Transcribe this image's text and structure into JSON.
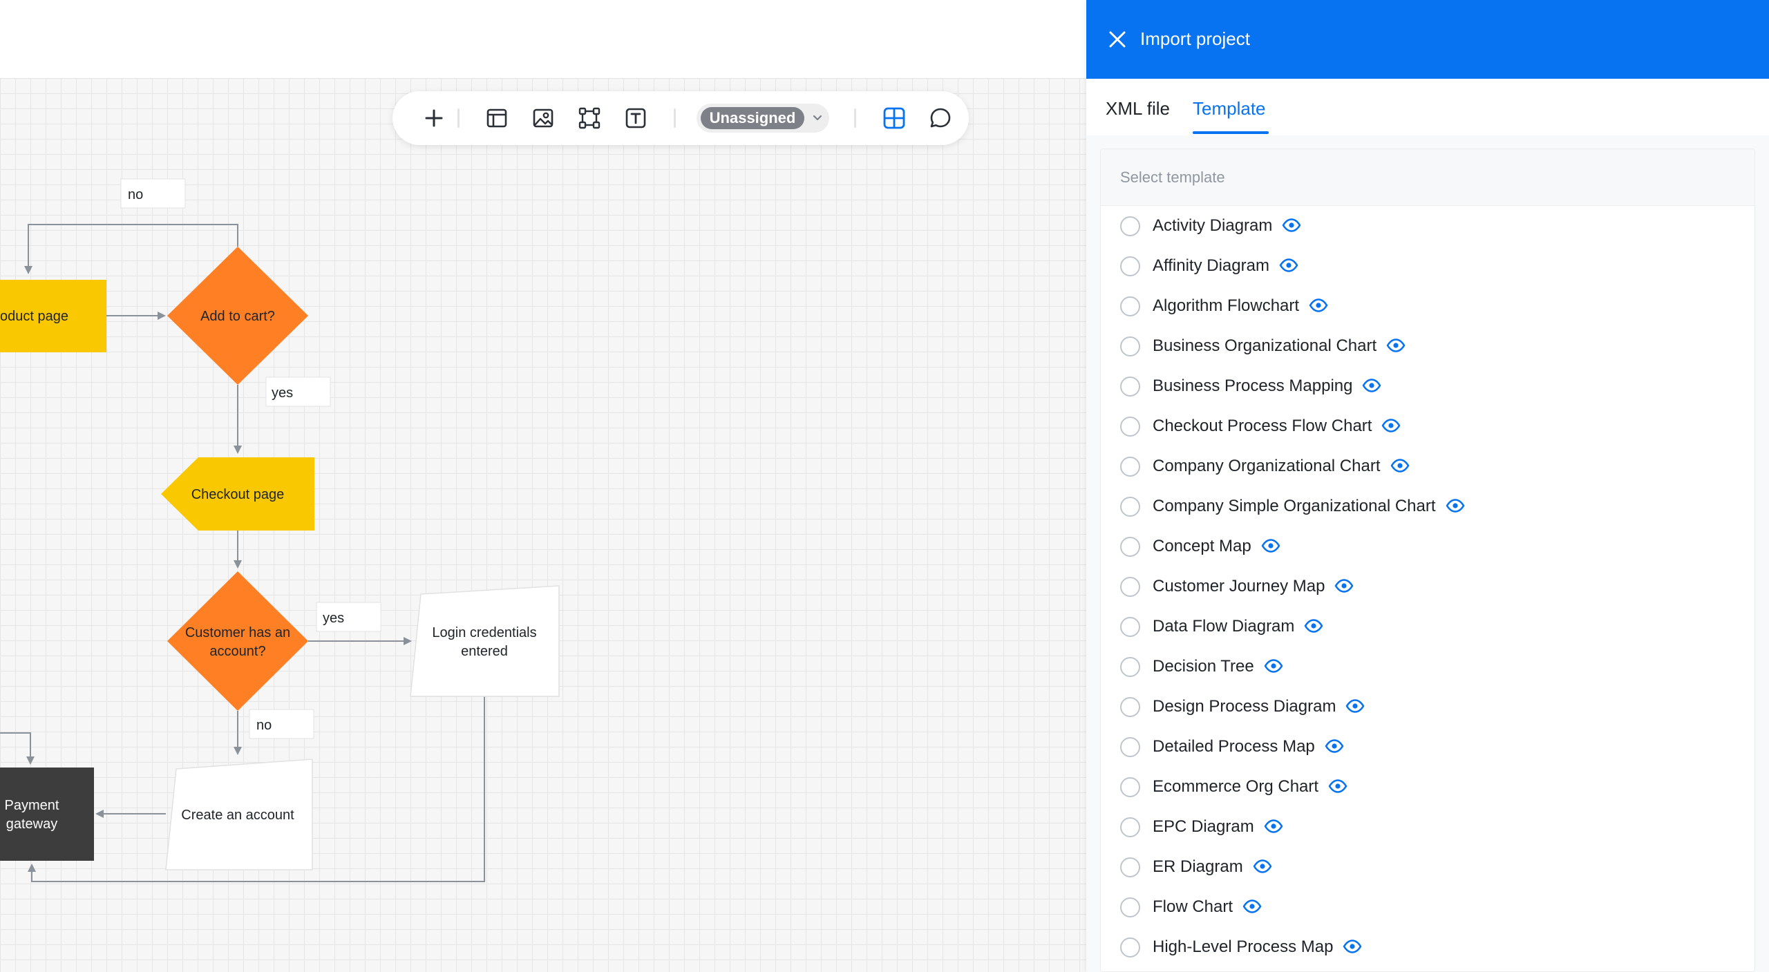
{
  "colors": {
    "accent": "#0773f0",
    "shape_yellow": "#fac800",
    "shape_orange": "#ff8024",
    "shape_dark": "#3d3d3d"
  },
  "toolbar": {
    "buttons": [
      "add-icon",
      "layout-icon",
      "image-icon",
      "frame-icon",
      "text-icon"
    ],
    "assign_label": "Unassigned",
    "right_buttons": [
      "grid-icon",
      "comment-icon"
    ]
  },
  "diagram": {
    "labels": {
      "no_top": "no",
      "yes_1": "yes",
      "yes_2": "yes",
      "no_bottom": "no"
    },
    "nodes": {
      "product_page": "oduct page",
      "add_to_cart": "Add to cart?",
      "checkout_page": "Checkout page",
      "customer_account_line1": "Customer has an",
      "customer_account_line2": "account?",
      "login_line1": "Login credentials",
      "login_line2": "entered",
      "payment_line1": "Payment",
      "payment_line2": "gateway",
      "create_account": "Create an account"
    }
  },
  "panel": {
    "title": "Import project",
    "tabs": [
      {
        "label": "XML file",
        "active": false
      },
      {
        "label": "Template",
        "active": true
      }
    ],
    "select_label": "Select template",
    "templates": [
      "Activity Diagram",
      "Affinity Diagram",
      "Algorithm Flowchart",
      "Business Organizational Chart",
      "Business Process Mapping",
      "Checkout Process Flow Chart",
      "Company Organizational Chart",
      "Company Simple Organizational Chart",
      "Concept Map",
      "Customer Journey Map",
      "Data Flow Diagram",
      "Decision Tree",
      "Design Process Diagram",
      "Detailed Process Map",
      "Ecommerce Org Chart",
      "EPC Diagram",
      "ER Diagram",
      "Flow Chart",
      "High-Level Process Map"
    ]
  }
}
